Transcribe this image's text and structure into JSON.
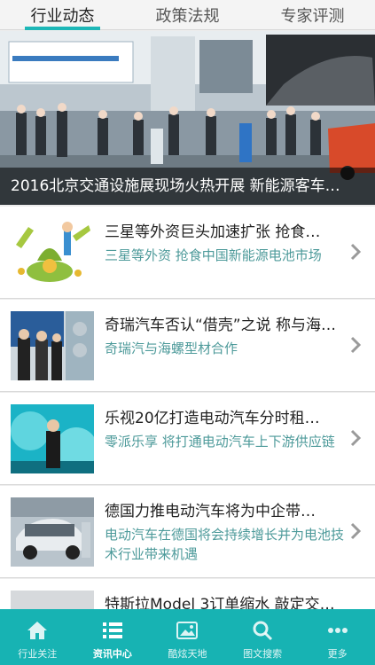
{
  "tabs": [
    {
      "label": "行业动态",
      "active": true
    },
    {
      "label": "政策法规",
      "active": false
    },
    {
      "label": "专家评测",
      "active": false
    }
  ],
  "hero": {
    "caption": "2016北京交通设施展现场火热开展  新能源客车…"
  },
  "news": [
    {
      "title": "三星等外资巨头加速扩张 抢食…",
      "desc": "三星等外资 抢食中国新能源电池市场",
      "thumb_icon": "money-bag-illustration"
    },
    {
      "title": "奇瑞汽车否认“借壳”之说 称与海…",
      "desc": "奇瑞汽与海螺型材合作",
      "thumb_icon": "press-conference-photo"
    },
    {
      "title": "乐视20亿打造电动汽车分时租…",
      "desc": "零派乐享 将打通电动汽车上下游供应链",
      "thumb_icon": "stage-speaker-photo"
    },
    {
      "title": "德国力推电动汽车将为中企带…",
      "desc": "电动汽车在德国将会持续增长并为电池技术行业带来机遇",
      "thumb_icon": "charging-car-photo"
    },
    {
      "title": "特斯拉Model 3订单缩水 敲定交…",
      "desc": "",
      "thumb_icon": "tesla-car-photo"
    }
  ],
  "bottom_nav": [
    {
      "label": "行业关注",
      "icon": "home-icon",
      "active": false
    },
    {
      "label": "资讯中心",
      "icon": "list-icon",
      "active": true
    },
    {
      "label": "酷炫天地",
      "icon": "image-icon",
      "active": false
    },
    {
      "label": "图文搜索",
      "icon": "search-icon",
      "active": false
    },
    {
      "label": "更多",
      "icon": "more-icon",
      "active": false
    }
  ],
  "colors": {
    "accent": "#17b3b3",
    "desc_text": "#4d9a9a"
  }
}
